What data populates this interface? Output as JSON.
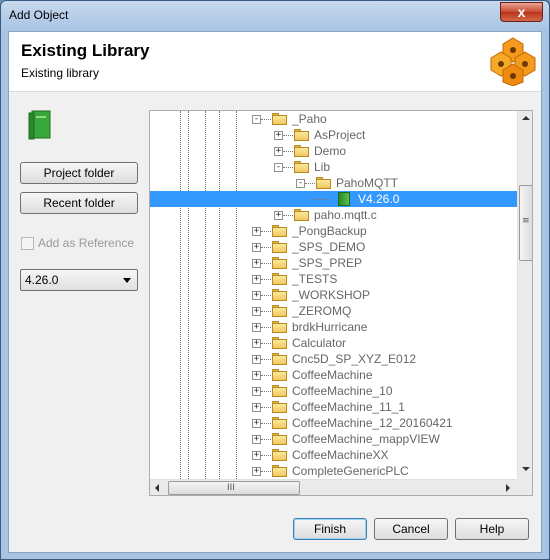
{
  "window": {
    "title": "Add Object",
    "close_symbol": "x"
  },
  "header": {
    "title": "Existing Library",
    "subtitle": "Existing library"
  },
  "left": {
    "project_folder": "Project folder",
    "recent_folder": "Recent folder",
    "add_as_reference": "Add as Reference",
    "version_selected": "4.26.0"
  },
  "tree": {
    "nodes": [
      {
        "label": "_Paho",
        "level": 0,
        "expander": "-",
        "icon": "folder-open"
      },
      {
        "label": "AsProject",
        "level": 1,
        "expander": "+",
        "icon": "folder"
      },
      {
        "label": "Demo",
        "level": 1,
        "expander": "+",
        "icon": "folder"
      },
      {
        "label": "Lib",
        "level": 1,
        "expander": "-",
        "icon": "folder-open"
      },
      {
        "label": "PahoMQTT",
        "level": 2,
        "expander": "-",
        "icon": "folder-open"
      },
      {
        "label": "V4.26.0",
        "level": 3,
        "expander": "",
        "icon": "library",
        "selected": true
      },
      {
        "label": "paho.mqtt.c",
        "level": 1,
        "expander": "+",
        "icon": "folder"
      },
      {
        "label": "_PongBackup",
        "level": 0,
        "expander": "+",
        "icon": "folder"
      },
      {
        "label": "_SPS_DEMO",
        "level": 0,
        "expander": "+",
        "icon": "folder"
      },
      {
        "label": "_SPS_PREP",
        "level": 0,
        "expander": "+",
        "icon": "folder"
      },
      {
        "label": "_TESTS",
        "level": 0,
        "expander": "+",
        "icon": "folder"
      },
      {
        "label": "_WORKSHOP",
        "level": 0,
        "expander": "+",
        "icon": "folder"
      },
      {
        "label": "_ZEROMQ",
        "level": 0,
        "expander": "+",
        "icon": "folder"
      },
      {
        "label": "brdkHurricane",
        "level": 0,
        "expander": "+",
        "icon": "folder"
      },
      {
        "label": "Calculator",
        "level": 0,
        "expander": "+",
        "icon": "folder"
      },
      {
        "label": "Cnc5D_SP_XYZ_E012",
        "level": 0,
        "expander": "+",
        "icon": "folder"
      },
      {
        "label": "CoffeeMachine",
        "level": 0,
        "expander": "+",
        "icon": "folder"
      },
      {
        "label": "CoffeeMachine_10",
        "level": 0,
        "expander": "+",
        "icon": "folder"
      },
      {
        "label": "CoffeeMachine_11_1",
        "level": 0,
        "expander": "+",
        "icon": "folder"
      },
      {
        "label": "CoffeeMachine_12_20160421",
        "level": 0,
        "expander": "+",
        "icon": "folder"
      },
      {
        "label": "CoffeeMachine_mappVIEW",
        "level": 0,
        "expander": "+",
        "icon": "folder"
      },
      {
        "label": "CoffeeMachineXX",
        "level": 0,
        "expander": "+",
        "icon": "folder"
      },
      {
        "label": "CompleteGenericPLC",
        "level": 0,
        "expander": "+",
        "icon": "folder"
      }
    ],
    "scroll_v_grip": "≡",
    "scroll_h_grip": "III"
  },
  "footer": {
    "finish": "Finish",
    "cancel": "Cancel",
    "help": "Help"
  },
  "colors": {
    "selection": "#3399ff",
    "client_bg": "#f0f0f0",
    "folder": "#f0c860"
  }
}
